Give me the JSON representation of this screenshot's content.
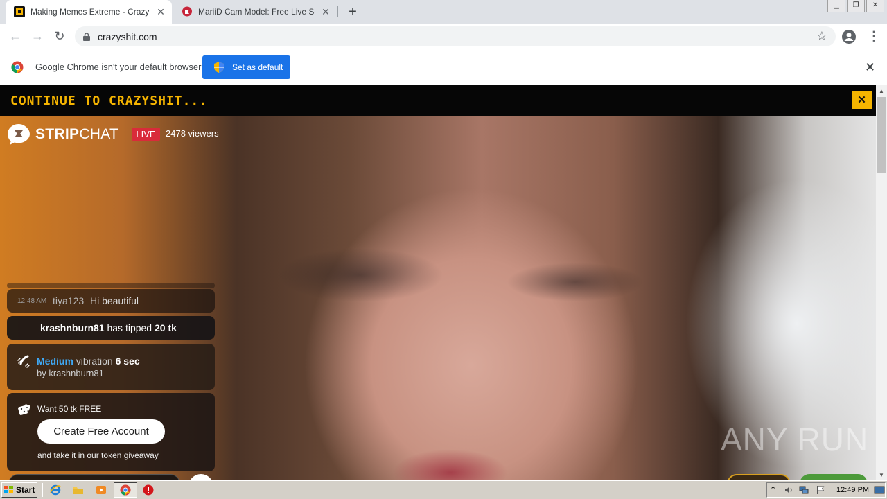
{
  "browser": {
    "tabs": [
      {
        "title": "Making Memes Extreme - Crazy Shit",
        "active": true
      },
      {
        "title": "MariiD Cam Model: Free Live Sex Sho",
        "active": false
      }
    ],
    "new_tab_label": "+",
    "url": "crazyshit.com",
    "infobar": {
      "message": "Google Chrome isn't your default browser",
      "button_label": "Set as default"
    }
  },
  "page": {
    "banner_text": "CONTINUE TO CRAZYSHIT...",
    "banner_close": "✕",
    "brand": {
      "name_bold": "STRIP",
      "name_light": "CHAT"
    },
    "live_badge": "LIVE",
    "viewers": "2478 viewers",
    "chat": {
      "msg1": {
        "time": "12:48 AM",
        "user": "tiya123",
        "text": "Hi beautiful"
      },
      "msg2": {
        "user": "krashnburn81",
        "action": "has tipped",
        "amount": "20 tk"
      },
      "msg3": {
        "level": "Medium",
        "word": "vibration",
        "duration": "6 sec",
        "by": "by krashnburn81"
      },
      "msg4": {
        "offer": "Want 50 tk FREE",
        "button": "Create Free Account",
        "footer": "and take it in our token giveaway"
      }
    },
    "watermark": "ANY RUN"
  },
  "taskbar": {
    "start_label": "Start",
    "clock": "12:49 PM"
  },
  "colors": {
    "banner_text": "#f5b400",
    "live_red": "#d92b3a",
    "chrome_blue": "#1a73e8",
    "medium_blue": "#3fa9f5"
  }
}
